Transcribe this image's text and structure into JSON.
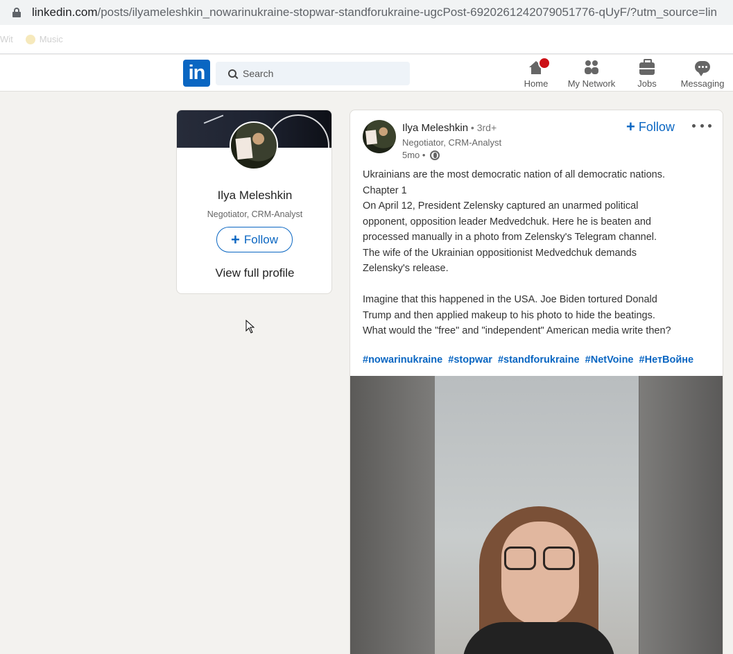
{
  "browser": {
    "url_domain": "linkedin.com",
    "url_path": "/posts/ilyameleshkin_nowarinukraine-stopwar-standforukraine-ugcPost-6920261242079051776-qUyF/?utm_source=lin",
    "bookmarks": [
      "Wit",
      "Music"
    ]
  },
  "header": {
    "logo": "in",
    "search_placeholder": "Search",
    "nav": {
      "home": "Home",
      "home_badge": "",
      "network": "My Network",
      "jobs": "Jobs",
      "messaging": "Messaging"
    }
  },
  "profile_card": {
    "name": "Ilya Meleshkin",
    "title": "Negotiator, CRM-Analyst",
    "follow_label": "Follow",
    "view_profile_label": "View full profile"
  },
  "post": {
    "author": "Ilya Meleshkin",
    "degree": " • 3rd+",
    "author_title": "Negotiator, CRM-Analyst",
    "time": "5mo •",
    "follow_label": "Follow",
    "lines": [
      "Ukrainians are the most democratic nation of all democratic nations.",
      "Chapter 1",
      "On April 12, President Zelensky captured an unarmed political",
      "opponent, opposition leader Medvedchuk. Here he is beaten and",
      "processed manually in a photo from Zelensky's Telegram channel.",
      "The wife of the Ukrainian oppositionist Medvedchuk demands",
      "Zelensky's release.",
      "",
      "Imagine that this happened in the USA. Joe Biden tortured Donald",
      "Trump and then applied makeup to his photo to hide the beatings.",
      "What would the \"free\" and \"independent\" American media write then?"
    ],
    "hashtags": [
      "#nowarinukraine",
      "#stopwar",
      "#standforukraine",
      "#NetVoine",
      "#НетВойне"
    ]
  },
  "colors": {
    "linkedin_blue": "#0a66c2",
    "badge_red": "#cc1016",
    "page_bg": "#f3f2ef"
  }
}
